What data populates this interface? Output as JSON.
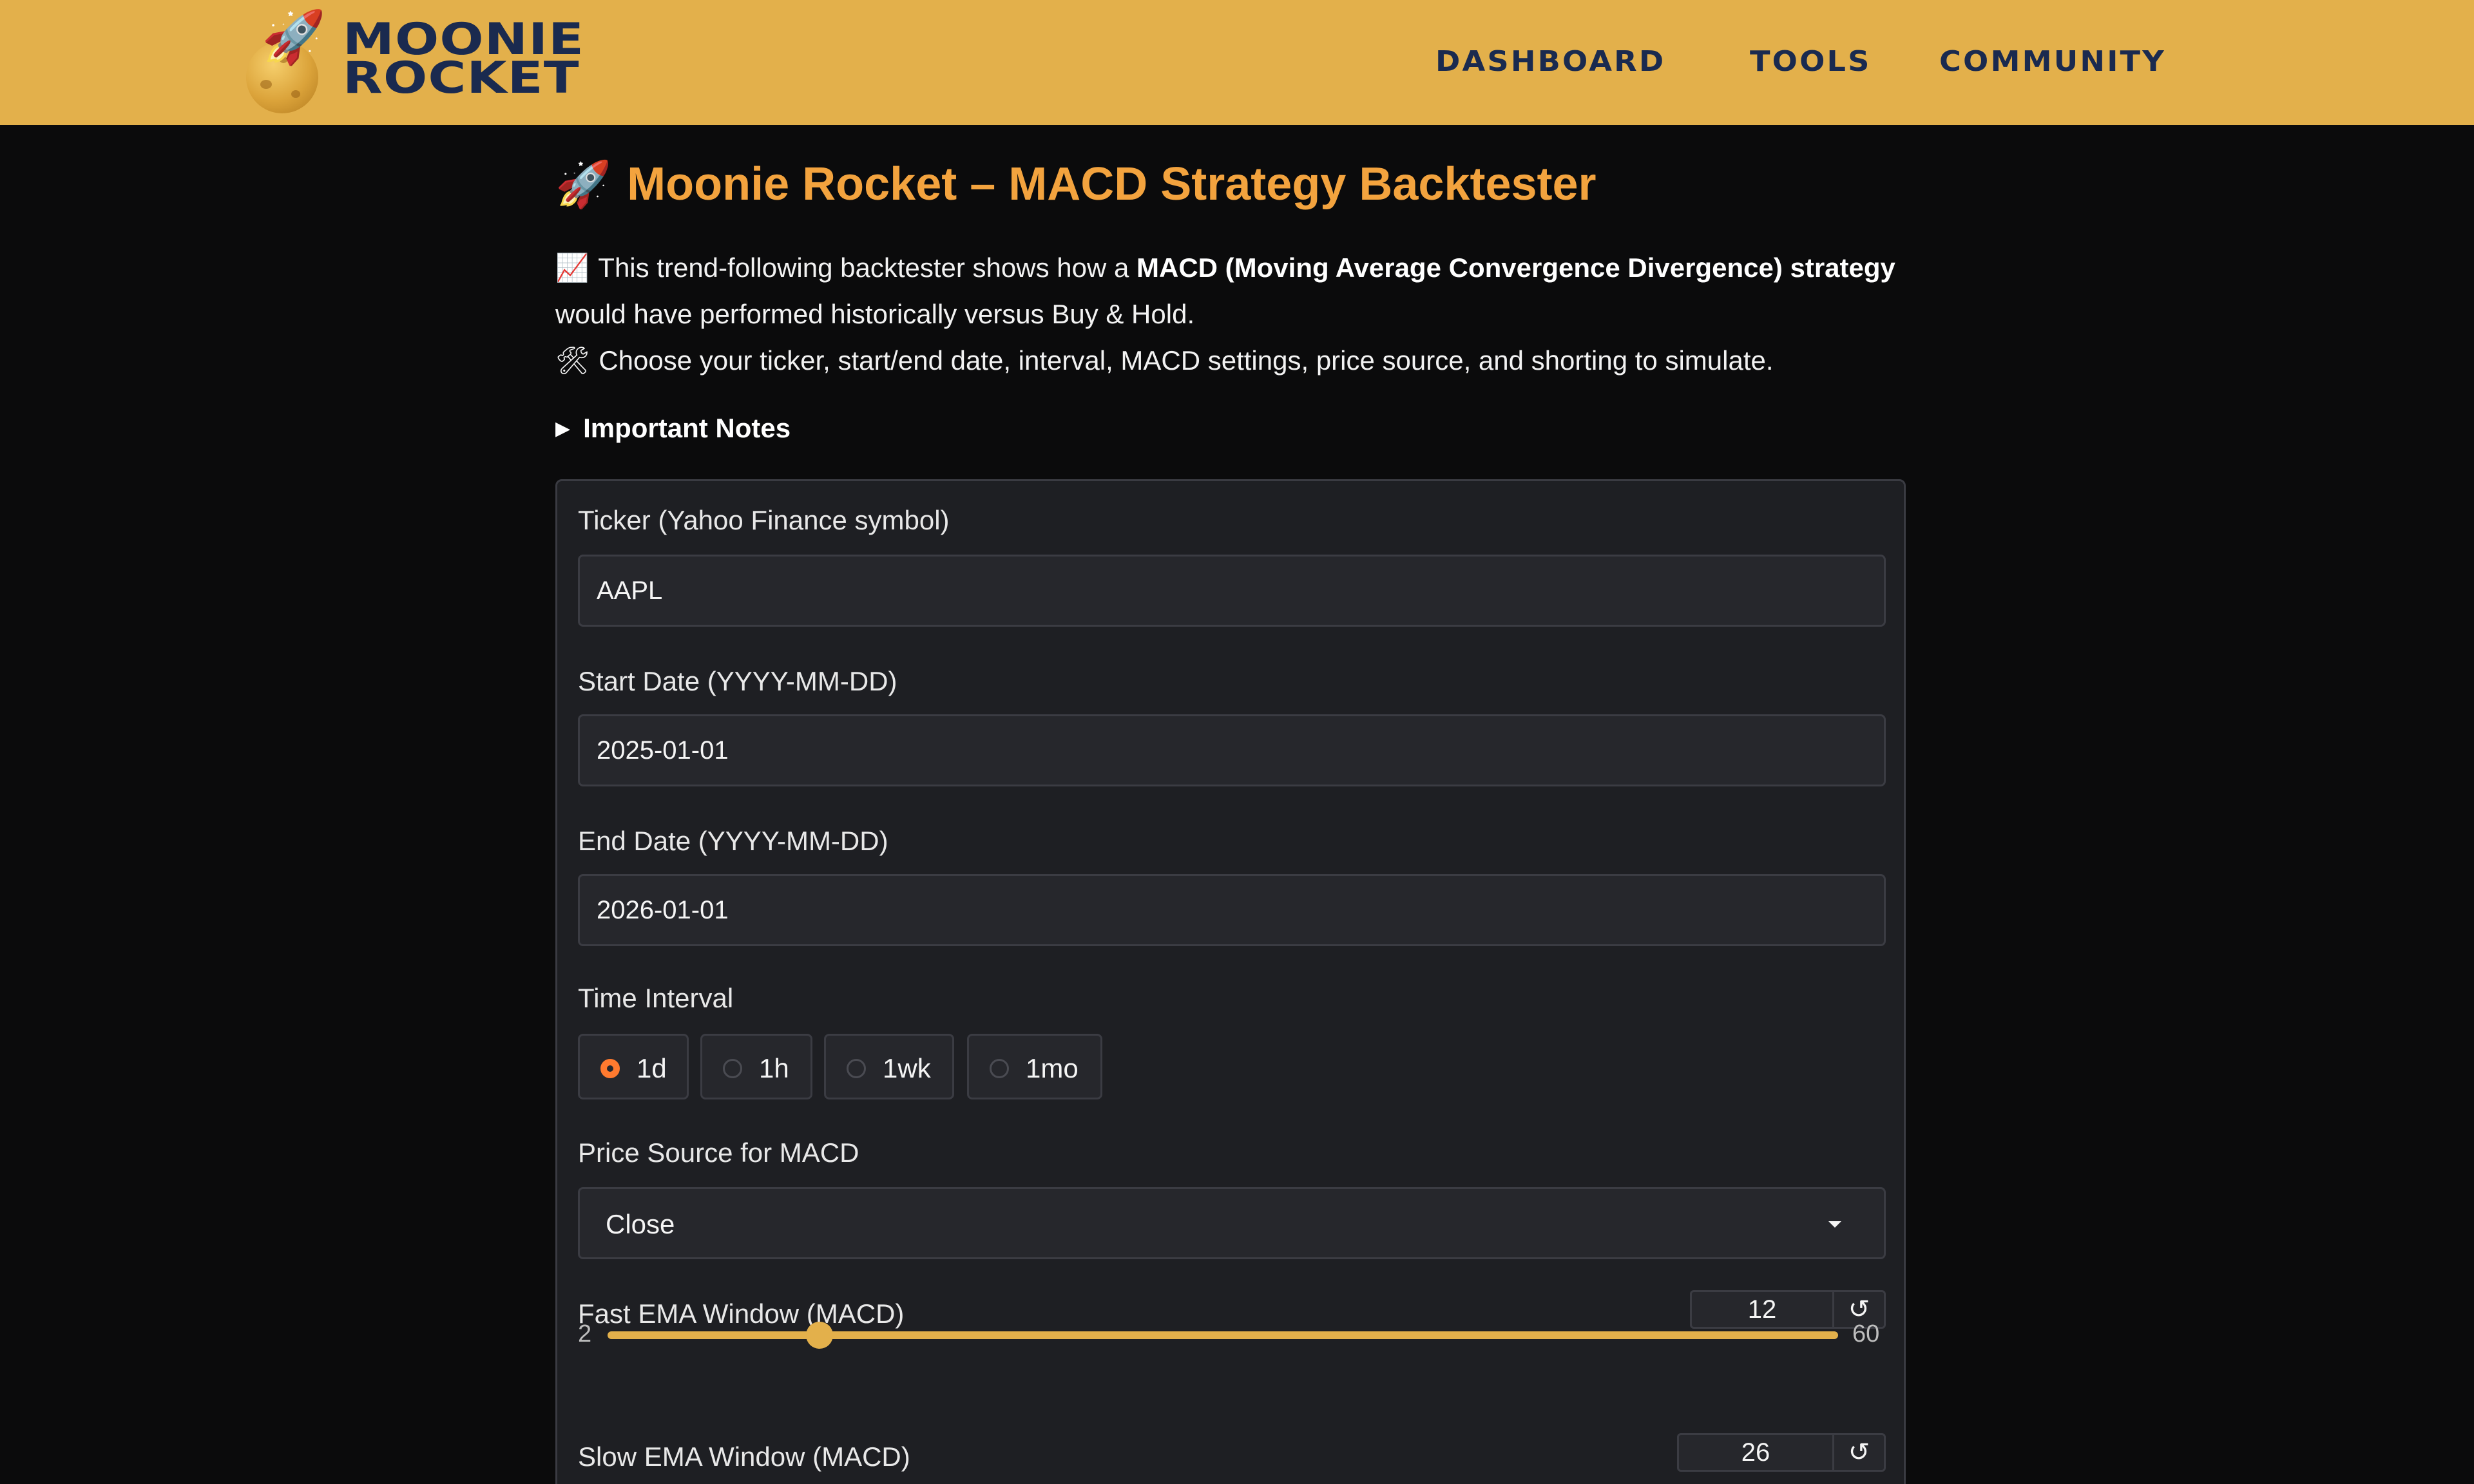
{
  "header": {
    "logo_line1": "MOONIE",
    "logo_line2": "ROCKET",
    "nav": [
      {
        "label": "DASHBOARD"
      },
      {
        "label": "TOOLS"
      },
      {
        "label": "COMMUNITY"
      }
    ],
    "bg_color": "#e3b04b",
    "text_color": "#1a2a4f"
  },
  "page": {
    "title_icon": "🚀",
    "title": "Moonie Rocket – MACD Strategy Backtester",
    "intro": {
      "line1_icon": "📈",
      "line1_pre": "This trend-following backtester shows how a ",
      "line1_bold": "MACD (Moving Average Convergence Divergence) strategy",
      "line1_post": " would have performed historically versus Buy & Hold.",
      "line2_icon": "🛠",
      "line2": "Choose your ticker, start/end date, interval, MACD settings, price source, and shorting to simulate."
    },
    "notes_label": "Important Notes",
    "accent_color": "#f3a33e"
  },
  "form": {
    "ticker": {
      "label": "Ticker (Yahoo Finance symbol)",
      "value": "AAPL"
    },
    "start_date": {
      "label": "Start Date (YYYY-MM-DD)",
      "value": "2025-01-01"
    },
    "end_date": {
      "label": "End Date (YYYY-MM-DD)",
      "value": "2026-01-01"
    },
    "interval": {
      "label": "Time Interval",
      "options": [
        "1d",
        "1h",
        "1wk",
        "1mo"
      ],
      "selected": "1d"
    },
    "price_source": {
      "label": "Price Source for MACD",
      "value": "Close"
    },
    "fast_ema": {
      "label": "Fast EMA Window (MACD)",
      "value": "12",
      "min": "2",
      "max": "60",
      "position": 0.1724
    },
    "slow_ema": {
      "label": "Slow EMA Window (MACD)",
      "value": "26"
    },
    "reset_icon": "↺"
  }
}
